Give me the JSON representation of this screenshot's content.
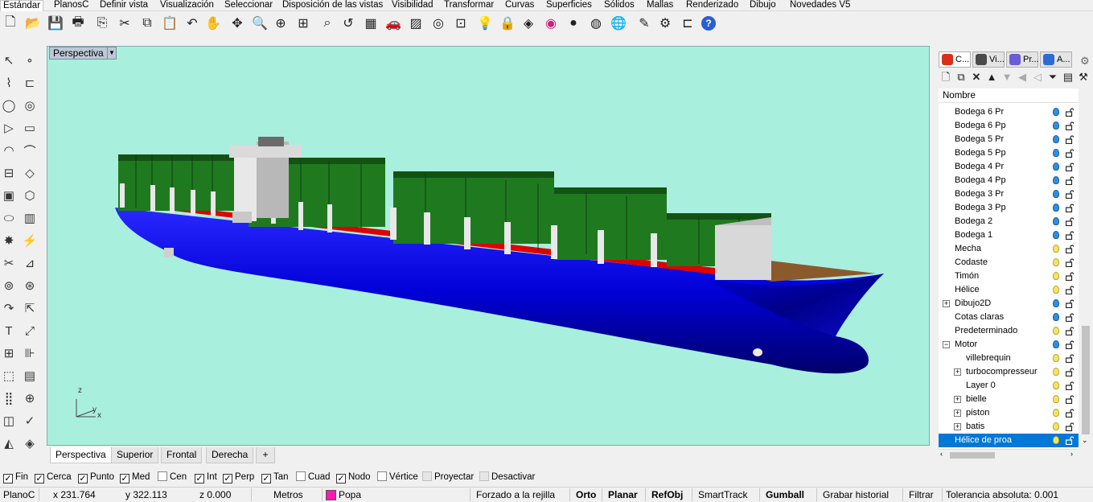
{
  "top_tabs": [
    "Estándar",
    "PlanosC",
    "Definir vista",
    "Visualización",
    "Seleccionar",
    "Disposición de las vistas",
    "Visibilidad",
    "Transformar",
    "Curvas",
    "Superficies",
    "Sólidos",
    "Mallas",
    "Renderizado",
    "Dibujo",
    "Novedades V5"
  ],
  "toolbar_icons": [
    "new-icon",
    "open-icon",
    "save-icon",
    "print-icon",
    "import-icon",
    "cut-icon",
    "copy-icon",
    "paste-icon",
    "undo-icon",
    "pan-hand-icon",
    "rotate-view-icon",
    "zoom-icon",
    "zoom-window-icon",
    "zoom-extents-icon",
    "zoom-selected-icon",
    "undo-view-icon",
    "four-viewports-icon",
    "car-icon",
    "grid-icon",
    "circle-snap-icon",
    "osnap-icon",
    "light-icon",
    "lock-icon",
    "layer-icon",
    "color-wheel-icon",
    "sphere-icon",
    "render-sphere-icon",
    "globe-icon",
    "properties-icon",
    "gear-icon",
    "dimension-icon",
    "help-icon"
  ],
  "left_toolbar_icons": [
    "select-arrow-icon",
    "point-icon",
    "polyline-icon",
    "curve-icon",
    "circle-icon",
    "ellipse-icon",
    "polygon-icon",
    "rectangle-icon",
    "arc-icon",
    "curve-edit-icon",
    "surface-icon",
    "surface-edit-icon",
    "box-icon",
    "solid-tools-icon",
    "cylinder-icon",
    "mesh-icon",
    "explode-icon",
    "join-icon",
    "trim-icon",
    "split-icon",
    "group-icon",
    "ungroup-icon",
    "fillet-icon",
    "offset-icon",
    "text-icon",
    "scale-icon",
    "array-icon",
    "align-icon",
    "box-edit-icon",
    "grid-snap-icon",
    "array-grid-icon",
    "block-icon",
    "mirror-icon",
    "check-icon",
    "shade-icon",
    "paint-icon"
  ],
  "viewport": {
    "title": "Perspectiva",
    "axis_labels": {
      "z": "z",
      "y": "y",
      "x": "x"
    }
  },
  "viewport_tabs": [
    "Perspectiva",
    "Superior",
    "Frontal",
    "Derecha"
  ],
  "panel_tabs": [
    {
      "label": "C...",
      "icon": "layers-icon",
      "color": "#d9301e"
    },
    {
      "label": "Vi...",
      "icon": "display-icon",
      "color": "#4a4a4a"
    },
    {
      "label": "Pr...",
      "icon": "properties-icon",
      "color": "#6b5bd6"
    },
    {
      "label": "A...",
      "icon": "help-icon",
      "color": "#2d6bd6"
    }
  ],
  "layer_tool_icons": [
    "new-layer-icon",
    "new-sublayer-icon",
    "delete-icon",
    "move-up-icon",
    "move-down-icon",
    "move-parent-icon",
    "collapse-icon",
    "filter-icon",
    "tool-icon",
    "wrench-icon"
  ],
  "layers": {
    "header": "Nombre",
    "items": [
      {
        "name": "Bodega 6 Pr",
        "indent": 0,
        "bulb": "on",
        "expand": ""
      },
      {
        "name": "Bodega 6 Pp",
        "indent": 0,
        "bulb": "on",
        "expand": ""
      },
      {
        "name": "Bodega 5 Pr",
        "indent": 0,
        "bulb": "on",
        "expand": ""
      },
      {
        "name": "Bodega 5 Pp",
        "indent": 0,
        "bulb": "on",
        "expand": ""
      },
      {
        "name": "Bodega 4 Pr",
        "indent": 0,
        "bulb": "on",
        "expand": ""
      },
      {
        "name": "Bodega 4 Pp",
        "indent": 0,
        "bulb": "on",
        "expand": ""
      },
      {
        "name": "Bodega 3 Pr",
        "indent": 0,
        "bulb": "on",
        "expand": ""
      },
      {
        "name": "Bodega 3 Pp",
        "indent": 0,
        "bulb": "on",
        "expand": ""
      },
      {
        "name": "Bodega 2",
        "indent": 0,
        "bulb": "on",
        "expand": ""
      },
      {
        "name": "Bodega 1",
        "indent": 0,
        "bulb": "on",
        "expand": ""
      },
      {
        "name": "Mecha",
        "indent": 0,
        "bulb": "off",
        "expand": ""
      },
      {
        "name": "Codaste",
        "indent": 0,
        "bulb": "off",
        "expand": ""
      },
      {
        "name": "Timón",
        "indent": 0,
        "bulb": "off",
        "expand": ""
      },
      {
        "name": "Hélice",
        "indent": 0,
        "bulb": "off",
        "expand": ""
      },
      {
        "name": "Dibujo2D",
        "indent": 0,
        "bulb": "on",
        "expand": "+"
      },
      {
        "name": "Cotas claras",
        "indent": 0,
        "bulb": "on",
        "expand": ""
      },
      {
        "name": "Predeterminado",
        "indent": 0,
        "bulb": "off",
        "expand": ""
      },
      {
        "name": "Motor",
        "indent": 0,
        "bulb": "on",
        "expand": "−"
      },
      {
        "name": "villebrequin",
        "indent": 1,
        "bulb": "off",
        "expand": ""
      },
      {
        "name": "turbocompresseur",
        "indent": 1,
        "bulb": "off",
        "expand": "+"
      },
      {
        "name": "Layer 0",
        "indent": 1,
        "bulb": "off",
        "expand": ""
      },
      {
        "name": "bielle",
        "indent": 1,
        "bulb": "off",
        "expand": "+"
      },
      {
        "name": "piston",
        "indent": 1,
        "bulb": "off",
        "expand": "+"
      },
      {
        "name": "batis",
        "indent": 1,
        "bulb": "off",
        "expand": "+"
      },
      {
        "name": "Hélice de proa",
        "indent": 0,
        "bulb": "off",
        "expand": "",
        "selected": true
      }
    ]
  },
  "osnaps": [
    {
      "label": "Fin",
      "checked": true
    },
    {
      "label": "Cerca",
      "checked": true
    },
    {
      "label": "Punto",
      "checked": true
    },
    {
      "label": "Med",
      "checked": true
    },
    {
      "label": "Cen",
      "checked": false
    },
    {
      "label": "Int",
      "checked": true
    },
    {
      "label": "Perp",
      "checked": true
    },
    {
      "label": "Tan",
      "checked": true
    },
    {
      "label": "Cuad",
      "checked": false
    },
    {
      "label": "Nodo",
      "checked": true
    },
    {
      "label": "Vértice",
      "checked": false
    },
    {
      "label": "Proyectar",
      "checked": false,
      "disabled": true
    },
    {
      "label": "Desactivar",
      "checked": false,
      "disabled": true
    }
  ],
  "status": {
    "cplane": "PlanoC",
    "x": "x 231.764",
    "y": "y 322.113",
    "z": "z 0.000",
    "units": "Metros",
    "layer": "Popa",
    "layer_color": "#ff1ab1",
    "toggles": [
      {
        "label": "Forzado a la rejilla",
        "bold": false
      },
      {
        "label": "Orto",
        "bold": true
      },
      {
        "label": "Planar",
        "bold": true
      },
      {
        "label": "RefObj",
        "bold": true
      },
      {
        "label": "SmartTrack",
        "bold": false
      },
      {
        "label": "Gumball",
        "bold": true
      },
      {
        "label": "Grabar historial",
        "bold": false
      },
      {
        "label": "Filtrar",
        "bold": false
      }
    ],
    "tolerance": "Tolerancia absoluta: 0.001"
  },
  "colors": {
    "viewport_bg": "#a9efde",
    "hull": "#0000e0",
    "container_green": "#1f7a1f",
    "waterline_red": "#e00000",
    "deck": "#8b5a2b",
    "selection": "#0078d7"
  }
}
